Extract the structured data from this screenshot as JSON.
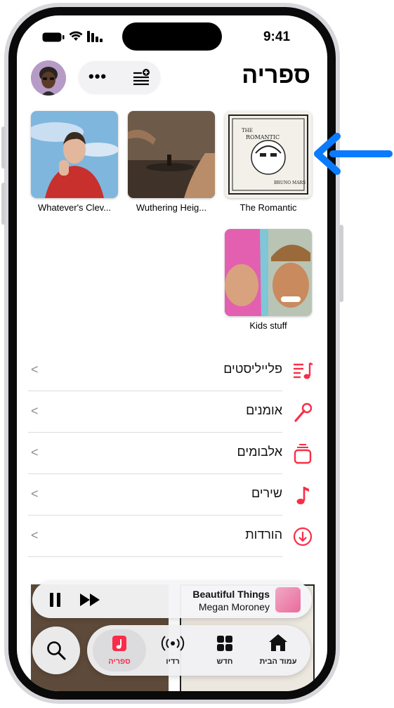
{
  "status_bar": {
    "time": "9:41"
  },
  "header": {
    "title": "ספריה"
  },
  "albums": [
    {
      "title": "Whatever's Clev..."
    },
    {
      "title": "Wuthering Heig..."
    },
    {
      "title": "The Romantic",
      "cover_text": [
        "THE",
        "ROMANTIC",
        "BRUNO MARS"
      ]
    },
    {
      "title": "Kids stuff"
    }
  ],
  "library_items": [
    {
      "label": "פלייליסטים",
      "icon": "playlist-icon"
    },
    {
      "label": "אומנים",
      "icon": "microphone-icon"
    },
    {
      "label": "אלבומים",
      "icon": "album-stack-icon"
    },
    {
      "label": "שירים",
      "icon": "music-note-icon"
    },
    {
      "label": "הורדות",
      "icon": "download-icon"
    }
  ],
  "now_playing": {
    "title": "Beautiful Things",
    "artist": "Megan Moroney"
  },
  "tabs": [
    {
      "label": "ספריה",
      "icon": "library-icon",
      "selected": true
    },
    {
      "label": "רדיו",
      "icon": "radio-icon"
    },
    {
      "label": "חדש",
      "icon": "grid-icon"
    },
    {
      "label": "עמוד הבית",
      "icon": "home-icon"
    }
  ],
  "colors": {
    "accent": "#fa2d48",
    "arrow": "#0a7aff"
  }
}
